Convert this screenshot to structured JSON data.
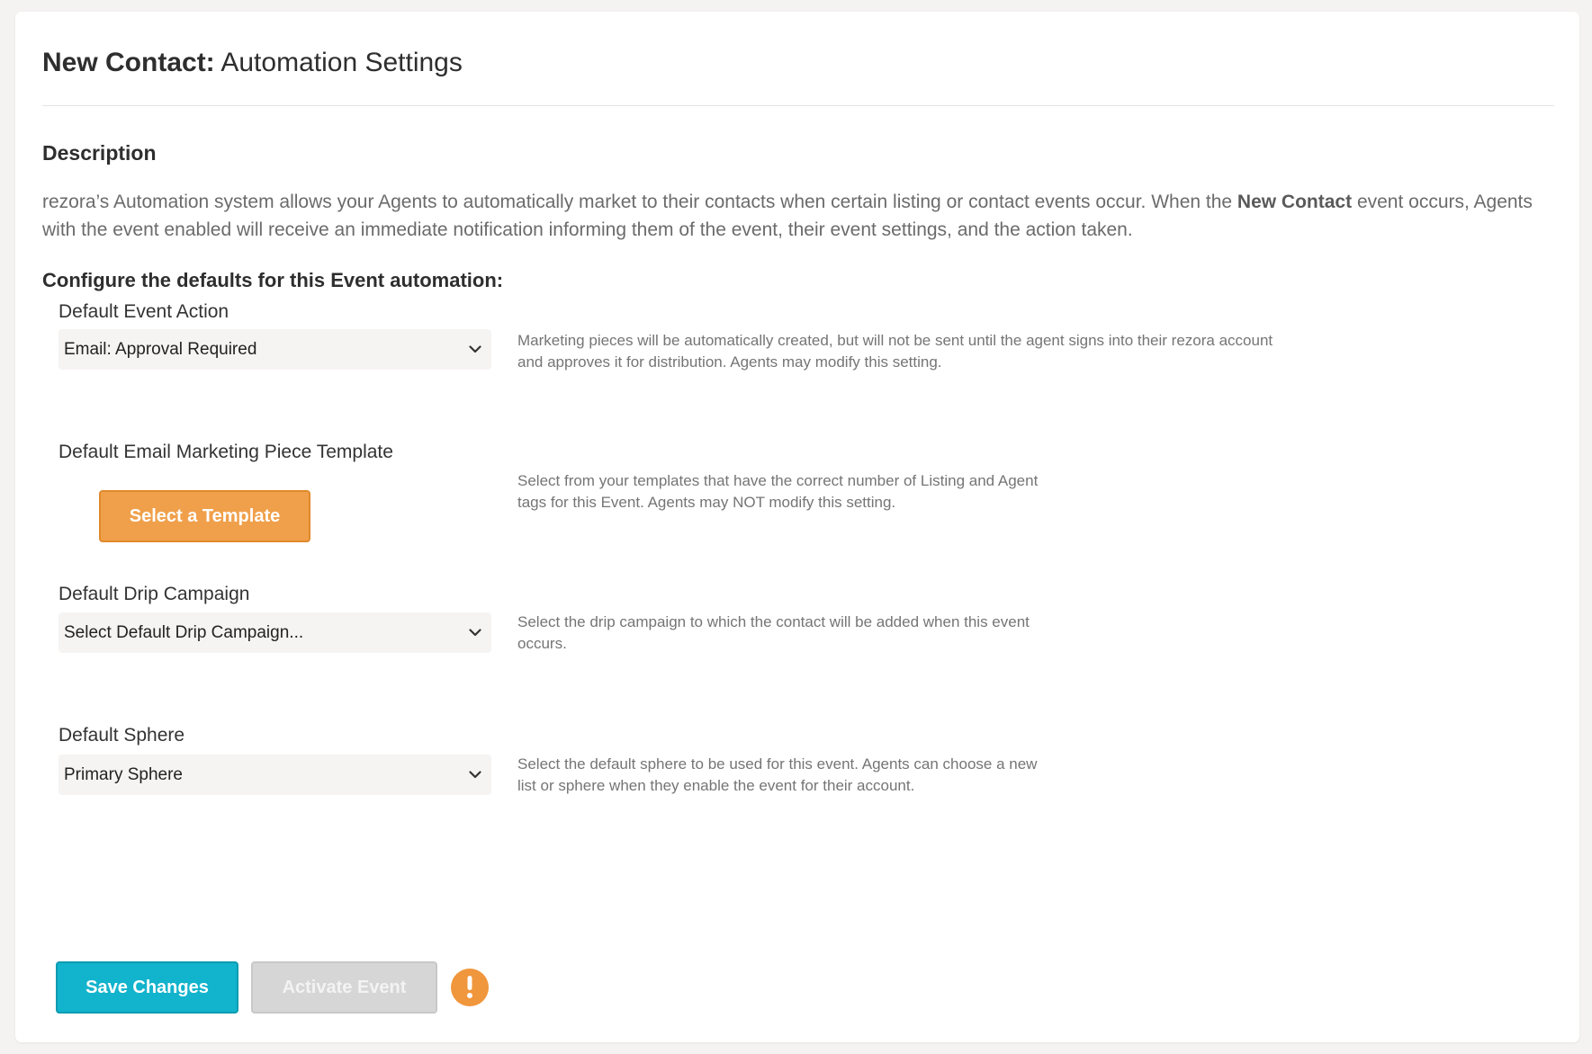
{
  "header": {
    "title_bold": "New Contact:",
    "title_rest": " Automation Settings"
  },
  "description": {
    "heading": "Description",
    "text_part1": "rezora’s Automation system allows your Agents to automatically market to their contacts when certain listing or contact events occur. When the ",
    "text_bold": "New Contact",
    "text_part2": " event occurs, Agents with the event enabled will receive an immediate notification informing them of the event, their event settings, and the action taken."
  },
  "configure": {
    "heading": "Configure the defaults for this Event automation:"
  },
  "event_action": {
    "label": "Default Event Action",
    "selected": "Email: Approval Required",
    "help": "Marketing pieces will be automatically created, but will not be sent until the agent signs into their rezora account and approves it for distribution. Agents may modify this setting."
  },
  "template": {
    "label": "Default Email Marketing Piece Template",
    "button_label": "Select a Template",
    "help": "Select from your templates that have the correct number of Listing and Agent tags for this Event. Agents may NOT modify this setting."
  },
  "drip_campaign": {
    "label": "Default Drip Campaign",
    "selected": "Select Default Drip Campaign...",
    "help": "Select the drip campaign to which the contact will be added when this event occurs."
  },
  "sphere": {
    "label": "Default Sphere",
    "selected": "Primary Sphere",
    "help": "Select the default sphere to be used for this event. Agents can choose a new list or sphere when they enable the event for their account."
  },
  "footer": {
    "save_label": "Save Changes",
    "activate_label": "Activate Event",
    "warning_icon": "exclamation-icon"
  },
  "colors": {
    "accent_teal": "#12b3cc",
    "accent_orange": "#f0a04b",
    "disabled_gray": "#d6d6d6"
  }
}
